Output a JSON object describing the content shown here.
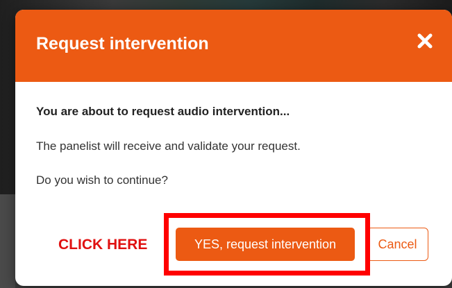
{
  "dialog": {
    "title": "Request intervention",
    "close_icon": "close-icon",
    "heading": "You are about to request audio intervention...",
    "line1": "The panelist will receive and validate your request.",
    "line2": "Do you wish to continue?",
    "confirm_label": "YES, request intervention",
    "cancel_label": "Cancel",
    "accent_color": "#ec5a13"
  },
  "annotation": {
    "callout_text": "CLICK HERE",
    "callout_color": "#e01010",
    "highlight_color": "#ff0000"
  }
}
